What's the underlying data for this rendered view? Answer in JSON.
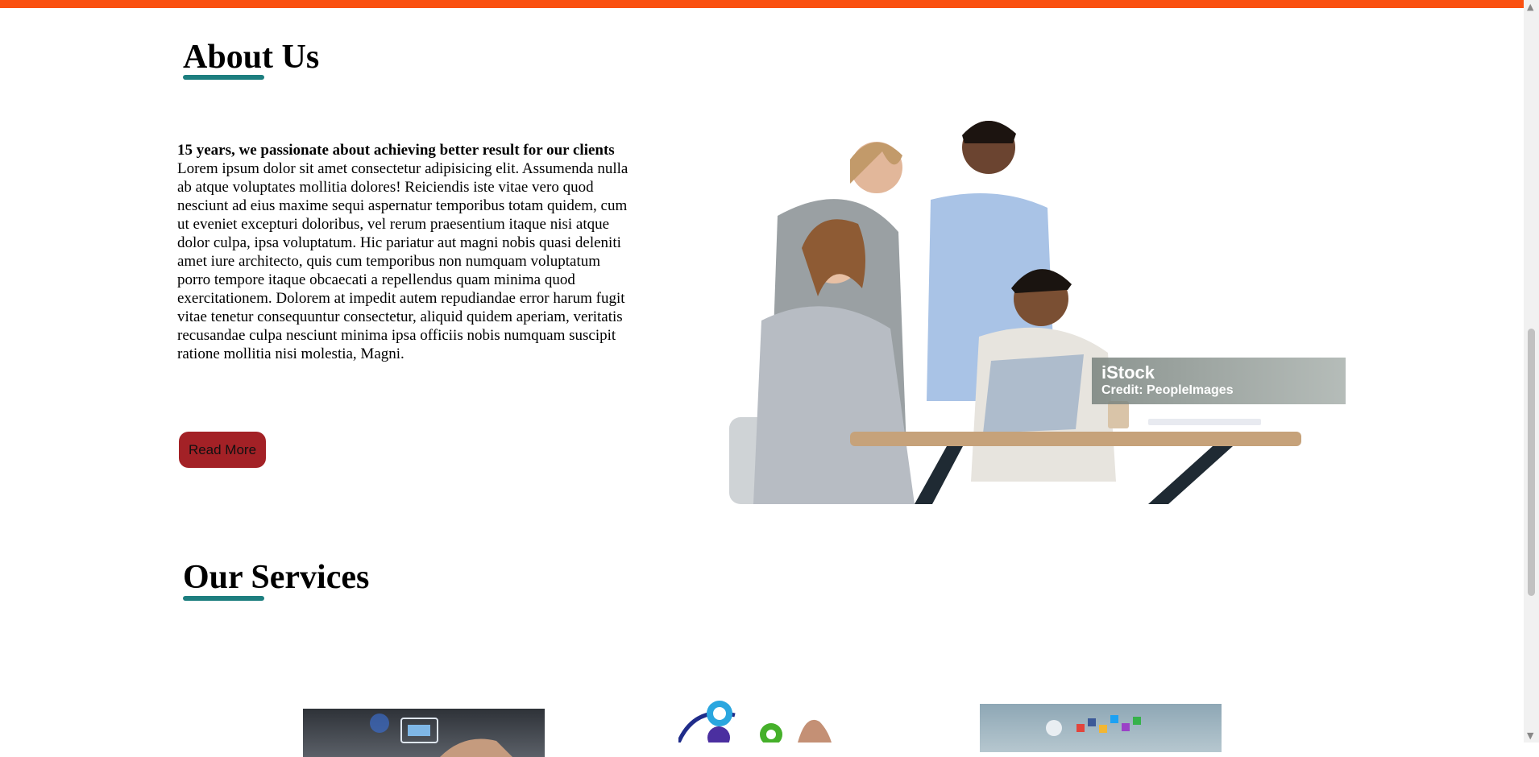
{
  "about": {
    "title": "About Us",
    "lead": "15 years, we passionate about achieving better result for our clients",
    "body": "Lorem ipsum dolor sit amet consectetur adipisicing elit. Assumenda nulla ab atque voluptates mollitia dolores! Reiciendis iste vitae vero quod nesciunt ad eius maxime sequi aspernatur temporibus totam quidem, cum ut eveniet excepturi doloribus, vel rerum praesentium itaque nisi atque dolor culpa, ipsa voluptatum. Hic pariatur aut magni nobis quasi deleniti amet iure architecto, quis cum temporibus non numquam voluptatum porro tempore itaque obcaecati a repellendus quam minima quod exercitationem. Dolorem at impedit autem repudiandae error harum fugit vitae tenetur consequuntur consectetur, aliquid quidem aperiam, veritatis recusandae culpa nesciunt minima ipsa officiis nobis numquam suscipit ratione mollitia nisi molestia, Magni.",
    "button_label": "Read More",
    "image": {
      "watermark_brand": "iStock",
      "watermark_credit": "Credit: PeopleImages"
    }
  },
  "services": {
    "title": "Our Services"
  },
  "colors": {
    "top_bar": "#fa5010",
    "underline": "#1d7e7f",
    "button": "#a32126"
  },
  "scrollbar": {
    "up_icon": "triangle-up-icon",
    "down_icon": "triangle-down-icon"
  }
}
